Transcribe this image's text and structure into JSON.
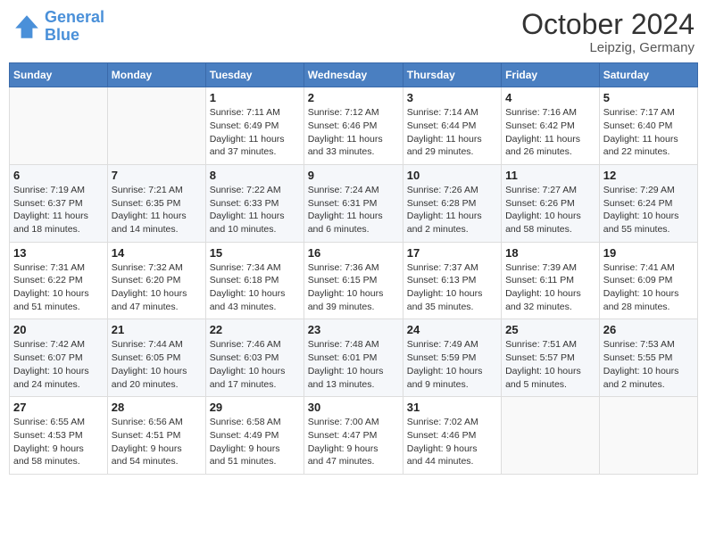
{
  "header": {
    "logo_line1": "General",
    "logo_line2": "Blue",
    "month": "October 2024",
    "location": "Leipzig, Germany"
  },
  "days_of_week": [
    "Sunday",
    "Monday",
    "Tuesday",
    "Wednesday",
    "Thursday",
    "Friday",
    "Saturday"
  ],
  "weeks": [
    [
      {
        "day": "",
        "info": ""
      },
      {
        "day": "",
        "info": ""
      },
      {
        "day": "1",
        "info": "Sunrise: 7:11 AM\nSunset: 6:49 PM\nDaylight: 11 hours\nand 37 minutes."
      },
      {
        "day": "2",
        "info": "Sunrise: 7:12 AM\nSunset: 6:46 PM\nDaylight: 11 hours\nand 33 minutes."
      },
      {
        "day": "3",
        "info": "Sunrise: 7:14 AM\nSunset: 6:44 PM\nDaylight: 11 hours\nand 29 minutes."
      },
      {
        "day": "4",
        "info": "Sunrise: 7:16 AM\nSunset: 6:42 PM\nDaylight: 11 hours\nand 26 minutes."
      },
      {
        "day": "5",
        "info": "Sunrise: 7:17 AM\nSunset: 6:40 PM\nDaylight: 11 hours\nand 22 minutes."
      }
    ],
    [
      {
        "day": "6",
        "info": "Sunrise: 7:19 AM\nSunset: 6:37 PM\nDaylight: 11 hours\nand 18 minutes."
      },
      {
        "day": "7",
        "info": "Sunrise: 7:21 AM\nSunset: 6:35 PM\nDaylight: 11 hours\nand 14 minutes."
      },
      {
        "day": "8",
        "info": "Sunrise: 7:22 AM\nSunset: 6:33 PM\nDaylight: 11 hours\nand 10 minutes."
      },
      {
        "day": "9",
        "info": "Sunrise: 7:24 AM\nSunset: 6:31 PM\nDaylight: 11 hours\nand 6 minutes."
      },
      {
        "day": "10",
        "info": "Sunrise: 7:26 AM\nSunset: 6:28 PM\nDaylight: 11 hours\nand 2 minutes."
      },
      {
        "day": "11",
        "info": "Sunrise: 7:27 AM\nSunset: 6:26 PM\nDaylight: 10 hours\nand 58 minutes."
      },
      {
        "day": "12",
        "info": "Sunrise: 7:29 AM\nSunset: 6:24 PM\nDaylight: 10 hours\nand 55 minutes."
      }
    ],
    [
      {
        "day": "13",
        "info": "Sunrise: 7:31 AM\nSunset: 6:22 PM\nDaylight: 10 hours\nand 51 minutes."
      },
      {
        "day": "14",
        "info": "Sunrise: 7:32 AM\nSunset: 6:20 PM\nDaylight: 10 hours\nand 47 minutes."
      },
      {
        "day": "15",
        "info": "Sunrise: 7:34 AM\nSunset: 6:18 PM\nDaylight: 10 hours\nand 43 minutes."
      },
      {
        "day": "16",
        "info": "Sunrise: 7:36 AM\nSunset: 6:15 PM\nDaylight: 10 hours\nand 39 minutes."
      },
      {
        "day": "17",
        "info": "Sunrise: 7:37 AM\nSunset: 6:13 PM\nDaylight: 10 hours\nand 35 minutes."
      },
      {
        "day": "18",
        "info": "Sunrise: 7:39 AM\nSunset: 6:11 PM\nDaylight: 10 hours\nand 32 minutes."
      },
      {
        "day": "19",
        "info": "Sunrise: 7:41 AM\nSunset: 6:09 PM\nDaylight: 10 hours\nand 28 minutes."
      }
    ],
    [
      {
        "day": "20",
        "info": "Sunrise: 7:42 AM\nSunset: 6:07 PM\nDaylight: 10 hours\nand 24 minutes."
      },
      {
        "day": "21",
        "info": "Sunrise: 7:44 AM\nSunset: 6:05 PM\nDaylight: 10 hours\nand 20 minutes."
      },
      {
        "day": "22",
        "info": "Sunrise: 7:46 AM\nSunset: 6:03 PM\nDaylight: 10 hours\nand 17 minutes."
      },
      {
        "day": "23",
        "info": "Sunrise: 7:48 AM\nSunset: 6:01 PM\nDaylight: 10 hours\nand 13 minutes."
      },
      {
        "day": "24",
        "info": "Sunrise: 7:49 AM\nSunset: 5:59 PM\nDaylight: 10 hours\nand 9 minutes."
      },
      {
        "day": "25",
        "info": "Sunrise: 7:51 AM\nSunset: 5:57 PM\nDaylight: 10 hours\nand 5 minutes."
      },
      {
        "day": "26",
        "info": "Sunrise: 7:53 AM\nSunset: 5:55 PM\nDaylight: 10 hours\nand 2 minutes."
      }
    ],
    [
      {
        "day": "27",
        "info": "Sunrise: 6:55 AM\nSunset: 4:53 PM\nDaylight: 9 hours\nand 58 minutes."
      },
      {
        "day": "28",
        "info": "Sunrise: 6:56 AM\nSunset: 4:51 PM\nDaylight: 9 hours\nand 54 minutes."
      },
      {
        "day": "29",
        "info": "Sunrise: 6:58 AM\nSunset: 4:49 PM\nDaylight: 9 hours\nand 51 minutes."
      },
      {
        "day": "30",
        "info": "Sunrise: 7:00 AM\nSunset: 4:47 PM\nDaylight: 9 hours\nand 47 minutes."
      },
      {
        "day": "31",
        "info": "Sunrise: 7:02 AM\nSunset: 4:46 PM\nDaylight: 9 hours\nand 44 minutes."
      },
      {
        "day": "",
        "info": ""
      },
      {
        "day": "",
        "info": ""
      }
    ]
  ]
}
